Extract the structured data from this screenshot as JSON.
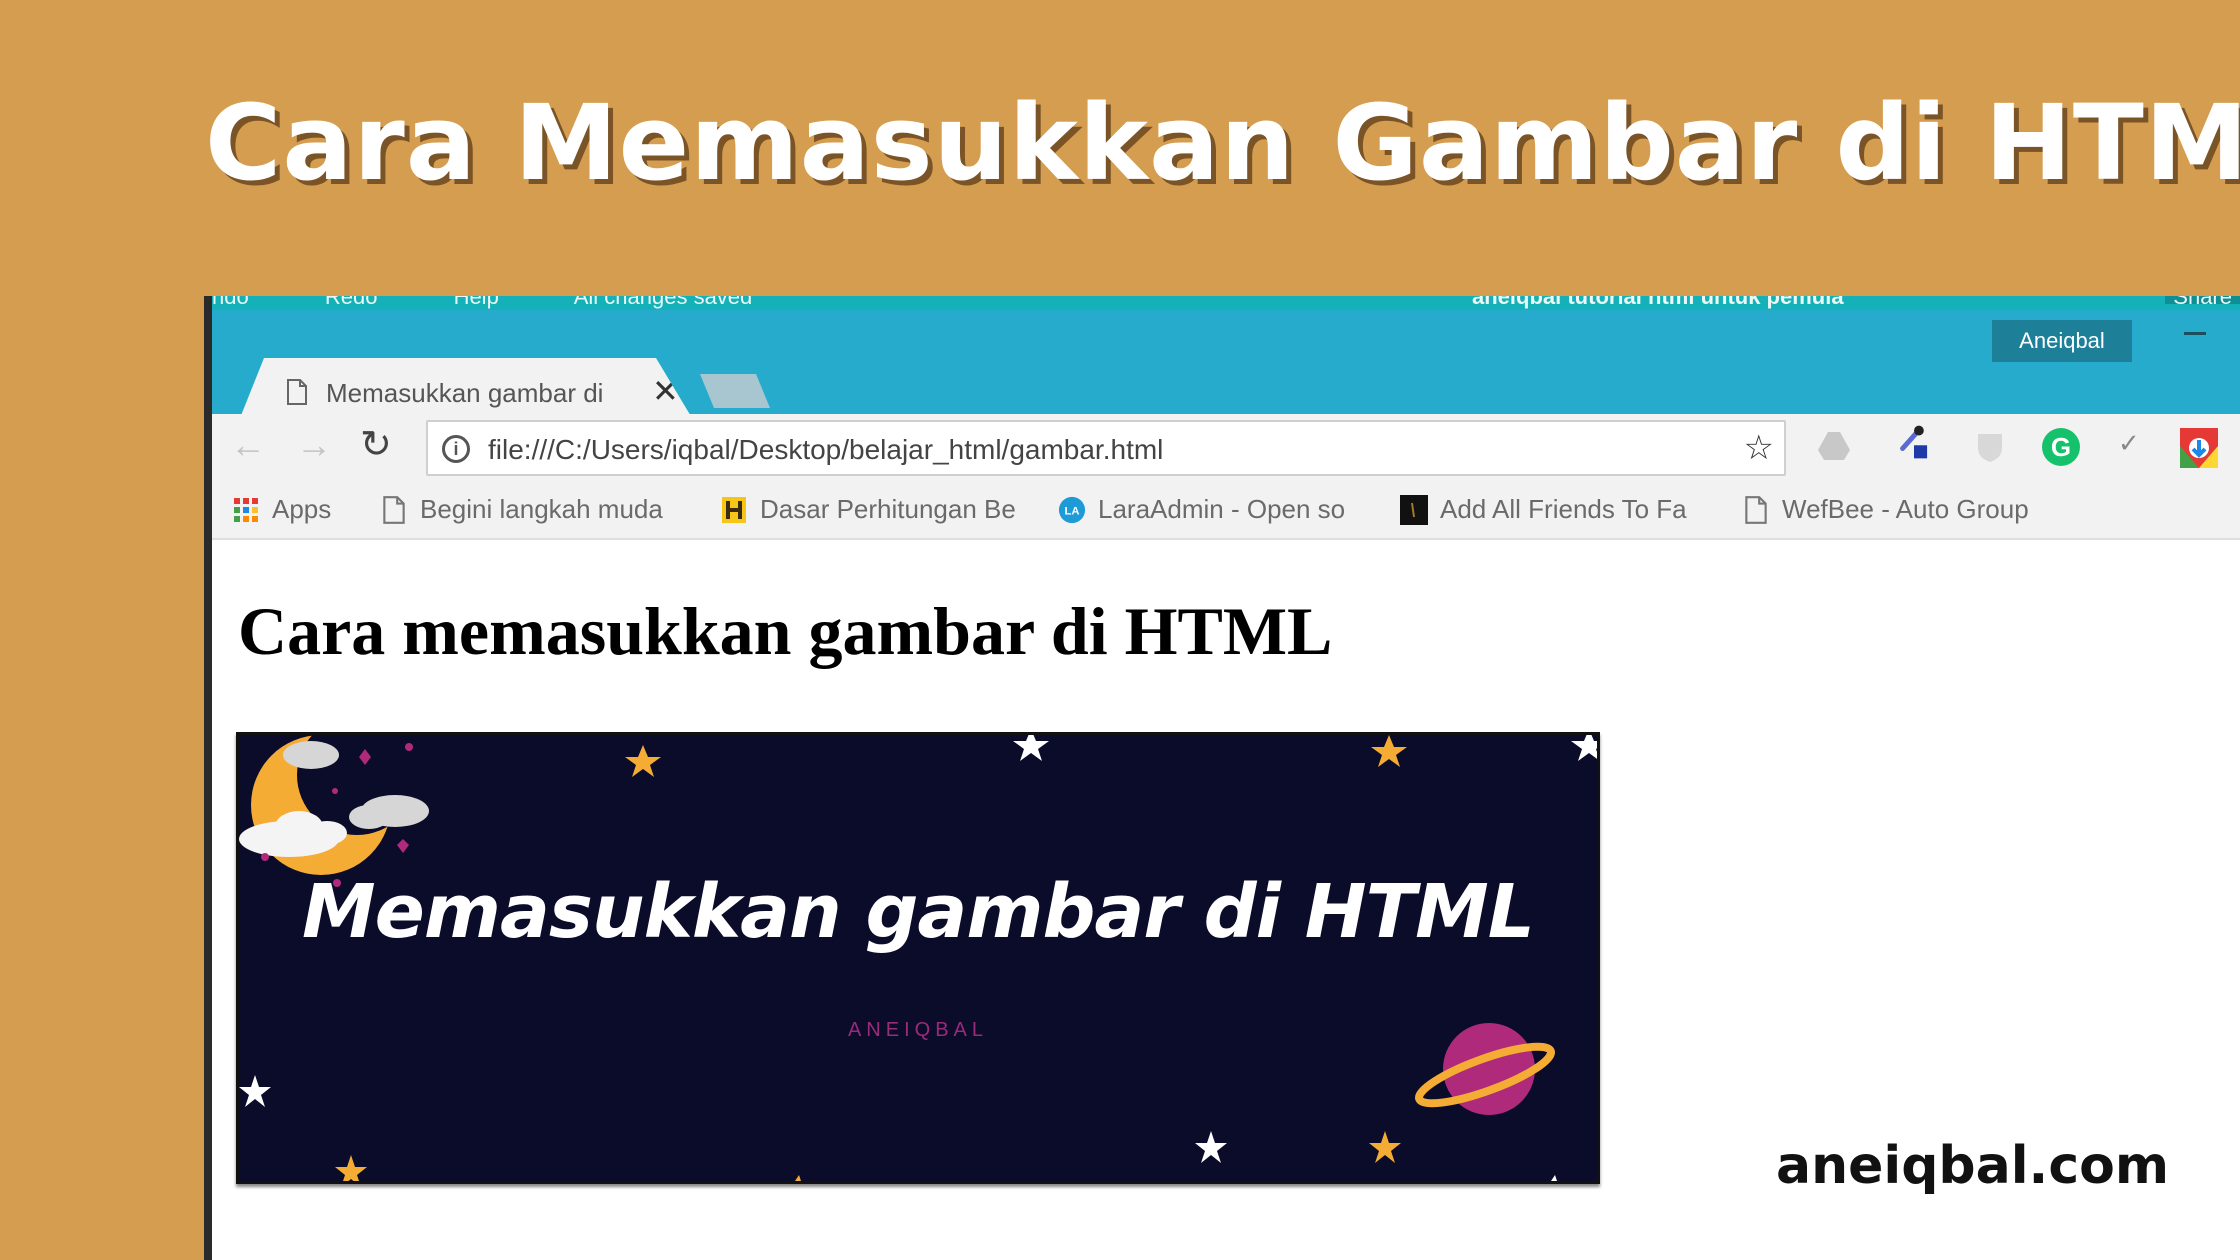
{
  "headline": "Cara Memasukkan Gambar di HTML",
  "watermark": "aneiqbal.com",
  "colors": {
    "background": "#d49d4f",
    "browser_titlebar": "#27abcd",
    "banner_background": "#0b0b2a",
    "moon": "#f5ac35",
    "planet": "#b02a7c"
  },
  "app_bar": {
    "menu_items": [
      "ndo",
      "Redo",
      "Help",
      "All changes saved"
    ],
    "document_name": "aneiqbal tutorial html untuk pemula",
    "share_label": "Share"
  },
  "browser": {
    "profile_name": "Aneiqbal",
    "tab": {
      "title": "Memasukkan gambar di",
      "icon": "page-icon",
      "close_icon": "close-icon"
    },
    "toolbar": {
      "back_icon": "arrow-left-icon",
      "forward_icon": "arrow-right-icon",
      "reload_icon": "reload-icon",
      "address": "file:///C:/Users/iqbal/Desktop/belajar_html/gambar.html",
      "site_info_icon": "info-icon",
      "bookmark_icon": "star-icon",
      "extensions": [
        "google-drive-icon",
        "color-picker-icon",
        "shield-icon",
        "grammarly-icon",
        "checkmark-icon",
        "download-icon"
      ]
    },
    "bookmarks": [
      {
        "label": "Apps",
        "icon": "apps-grid-icon"
      },
      {
        "label": "Begini langkah muda",
        "icon": "page-icon"
      },
      {
        "label": "Dasar Perhitungan Be",
        "icon": "site-icon"
      },
      {
        "label": "LaraAdmin - Open so",
        "icon": "laraadmin-icon"
      },
      {
        "label": "Add All Friends To Fa",
        "icon": "site-icon"
      },
      {
        "label": "WefBee - Auto Group",
        "icon": "page-icon"
      }
    ]
  },
  "page": {
    "heading": "Cara memasukkan gambar di HTML",
    "image": {
      "title": "Memasukkan gambar di HTML",
      "subtitle": "ANEIQBAL"
    }
  }
}
